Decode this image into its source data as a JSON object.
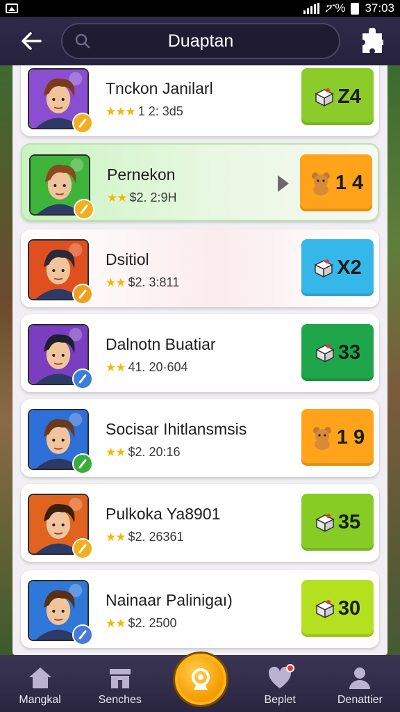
{
  "status_bar": {
    "time": "37:03",
    "carrier": "ፖ%"
  },
  "header": {
    "search_text": "Duaptan"
  },
  "items": [
    {
      "title": "Tnckon Janilarl",
      "meta": "1 2: 3d5",
      "stars": "★★★",
      "price": "Z4",
      "price_color": "#8bcc2a",
      "avatar_bg": "#8a4fd0",
      "badge_color": "#f0b020"
    },
    {
      "title": "Pernekon",
      "meta": "$2. 2:9H",
      "stars": "★★",
      "price": "1 4",
      "price_color": "#ffa41a",
      "avatar_bg": "#3fb43a",
      "badge_color": "#f0b020"
    },
    {
      "title": "Dsitiol",
      "meta": "$2. 3:811",
      "stars": "★★",
      "price": "X2",
      "price_color": "#36b7ea",
      "avatar_bg": "#e0501f",
      "badge_color": "#f0a020"
    },
    {
      "title": "Dalnotn Buatiar",
      "meta": "41. 20·604",
      "stars": "★★",
      "price": "33",
      "price_color": "#1fa64a",
      "avatar_bg": "#7a3fc0",
      "badge_color": "#3b7fd8"
    },
    {
      "title": "Socisar Ihitlansmsis",
      "meta": "$2. 20:16",
      "stars": "★★",
      "price": "1 9",
      "price_color": "#ffa41a",
      "avatar_bg": "#2f6fd8",
      "badge_color": "#3aae3a"
    },
    {
      "title": "Pulkoka Ya8901",
      "meta": "$2. 26361",
      "stars": "★★",
      "price": "35",
      "price_color": "#86cc24",
      "avatar_bg": "#e0641f",
      "badge_color": "#f0b020"
    },
    {
      "title": "Nainaar Palinigaı)",
      "meta": "$2. 2500",
      "stars": "★★",
      "price": "30",
      "price_color": "#b5e020",
      "avatar_bg": "#2f78d8",
      "badge_color": "#4a7ad8"
    }
  ],
  "nav": {
    "items": [
      {
        "label": "Mangkal"
      },
      {
        "label": "Senches"
      },
      {
        "label": "Beplet"
      },
      {
        "label": "Denattier"
      }
    ]
  }
}
